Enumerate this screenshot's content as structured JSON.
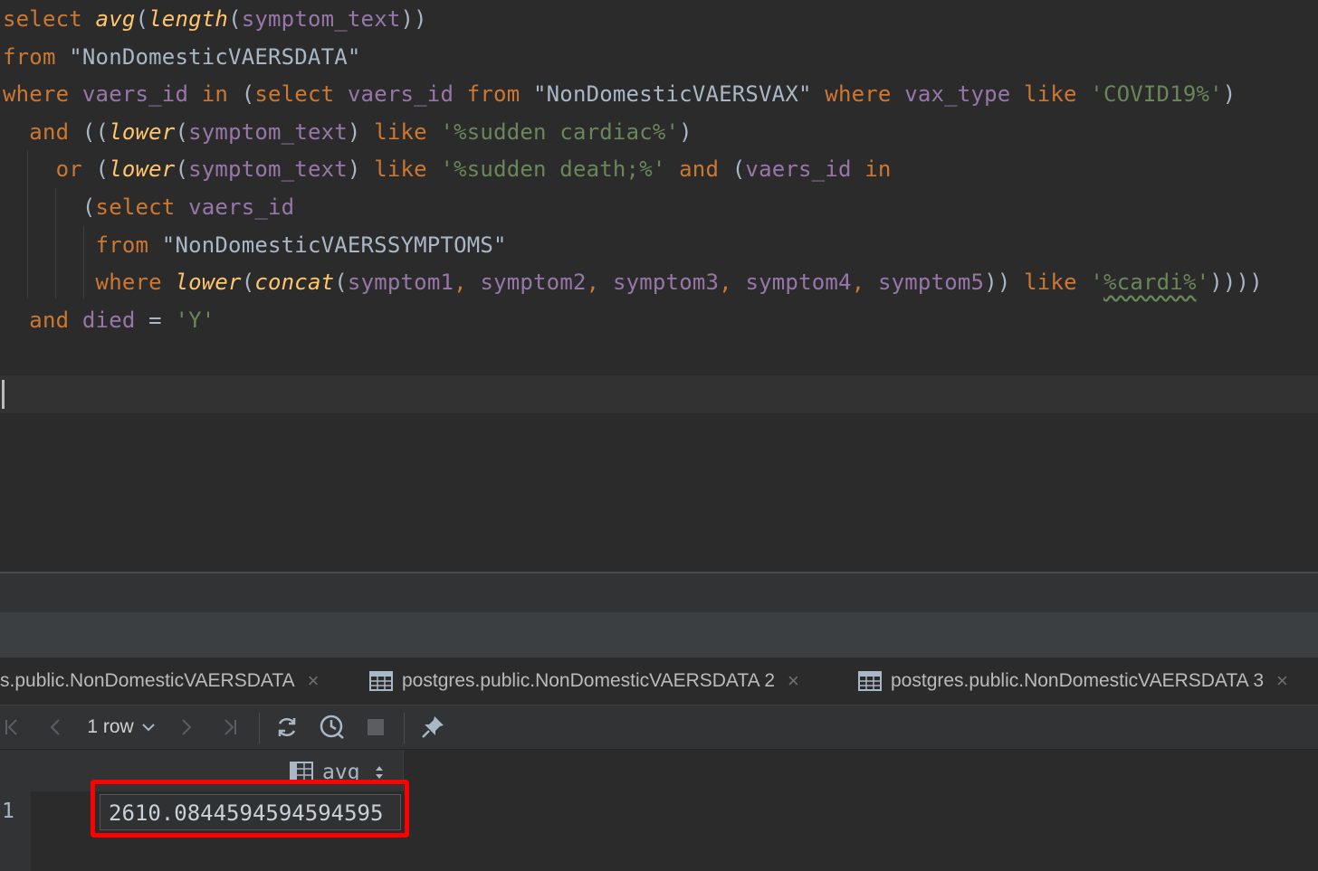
{
  "editor": {
    "lines": [
      [
        {
          "t": "select ",
          "c": "kw"
        },
        {
          "t": "avg",
          "c": "fn"
        },
        {
          "t": "(",
          "c": ""
        },
        {
          "t": "length",
          "c": "fn"
        },
        {
          "t": "(",
          "c": ""
        },
        {
          "t": "symptom_text",
          "c": "id"
        },
        {
          "t": "))",
          "c": ""
        }
      ],
      [
        {
          "t": "from ",
          "c": "kw"
        },
        {
          "t": "\"NonDomesticVAERSDATA\"",
          "c": "qid"
        }
      ],
      [
        {
          "t": "where ",
          "c": "kw"
        },
        {
          "t": "vaers_id ",
          "c": "id"
        },
        {
          "t": "in ",
          "c": "kw"
        },
        {
          "t": "(",
          "c": ""
        },
        {
          "t": "select ",
          "c": "kw"
        },
        {
          "t": "vaers_id ",
          "c": "id"
        },
        {
          "t": "from ",
          "c": "kw"
        },
        {
          "t": "\"NonDomesticVAERSVAX\" ",
          "c": "qid"
        },
        {
          "t": "where ",
          "c": "kw"
        },
        {
          "t": "vax_type ",
          "c": "id"
        },
        {
          "t": "like ",
          "c": "kw"
        },
        {
          "t": "'COVID19%'",
          "c": "str"
        },
        {
          "t": ")",
          "c": ""
        }
      ],
      [
        {
          "t": "  and ",
          "c": "kw"
        },
        {
          "t": "((",
          "c": ""
        },
        {
          "t": "lower",
          "c": "fn"
        },
        {
          "t": "(",
          "c": ""
        },
        {
          "t": "symptom_text",
          "c": "id"
        },
        {
          "t": ") ",
          "c": ""
        },
        {
          "t": "like ",
          "c": "kw"
        },
        {
          "t": "'%sudden cardiac%'",
          "c": "str"
        },
        {
          "t": ")",
          "c": ""
        }
      ],
      [
        {
          "t": "    or ",
          "c": "kw"
        },
        {
          "t": "(",
          "c": ""
        },
        {
          "t": "lower",
          "c": "fn"
        },
        {
          "t": "(",
          "c": ""
        },
        {
          "t": "symptom_text",
          "c": "id"
        },
        {
          "t": ") ",
          "c": ""
        },
        {
          "t": "like ",
          "c": "kw"
        },
        {
          "t": "'%sudden death;%' ",
          "c": "str"
        },
        {
          "t": "and ",
          "c": "kw"
        },
        {
          "t": "(",
          "c": ""
        },
        {
          "t": "vaers_id ",
          "c": "id"
        },
        {
          "t": "in",
          "c": "kw"
        }
      ],
      [
        {
          "t": "      (",
          "c": ""
        },
        {
          "t": "select ",
          "c": "kw"
        },
        {
          "t": "vaers_id",
          "c": "id"
        }
      ],
      [
        {
          "t": "       from ",
          "c": "kw"
        },
        {
          "t": "\"NonDomesticVAERSSYMPTOMS\"",
          "c": "qid"
        }
      ],
      [
        {
          "t": "       where ",
          "c": "kw"
        },
        {
          "t": "lower",
          "c": "fn"
        },
        {
          "t": "(",
          "c": ""
        },
        {
          "t": "concat",
          "c": "fn"
        },
        {
          "t": "(",
          "c": ""
        },
        {
          "t": "symptom1",
          "c": "id"
        },
        {
          "t": ", ",
          "c": "kw"
        },
        {
          "t": "symptom2",
          "c": "id"
        },
        {
          "t": ", ",
          "c": "kw"
        },
        {
          "t": "symptom3",
          "c": "id"
        },
        {
          "t": ", ",
          "c": "kw"
        },
        {
          "t": "symptom4",
          "c": "id"
        },
        {
          "t": ", ",
          "c": "kw"
        },
        {
          "t": "symptom5",
          "c": "id"
        },
        {
          "t": ")) ",
          "c": ""
        },
        {
          "t": "like ",
          "c": "kw"
        },
        {
          "t": "'",
          "c": "str"
        },
        {
          "t": "%cardi%",
          "c": "str squig"
        },
        {
          "t": "'",
          "c": "str"
        },
        {
          "t": "))))",
          "c": ""
        }
      ],
      [
        {
          "t": "  and ",
          "c": "kw"
        },
        {
          "t": "died ",
          "c": "id"
        },
        {
          "t": "= ",
          "c": ""
        },
        {
          "t": "'Y'",
          "c": "str"
        }
      ]
    ]
  },
  "tabs": [
    {
      "label": "s.public.NonDomesticVAERSDATA",
      "icon": "table-grid-icon",
      "close": "×"
    },
    {
      "label": "postgres.public.NonDomesticVAERSDATA 2",
      "icon": "table-grid-icon",
      "close": "×"
    },
    {
      "label": "postgres.public.NonDomesticVAERSDATA 3",
      "icon": "table-grid-icon",
      "close": "×"
    }
  ],
  "toolbar": {
    "rows_label": "1 row",
    "first_icon": "first-page-icon",
    "prev_icon": "previous-page-icon",
    "next_icon": "next-page-icon",
    "last_icon": "last-page-icon",
    "reload_icon": "reload-icon",
    "history_icon": "history-icon",
    "stop_icon": "stop-icon",
    "pin_icon": "pin-icon"
  },
  "results": {
    "column": "avg",
    "rows": [
      {
        "num": "1",
        "avg": "2610.0844594594594595"
      }
    ]
  },
  "colors": {
    "keyword": "#cc7832",
    "function": "#ffc66d",
    "identifier": "#9876aa",
    "string": "#6a8759",
    "highlight": "#ff0000"
  }
}
